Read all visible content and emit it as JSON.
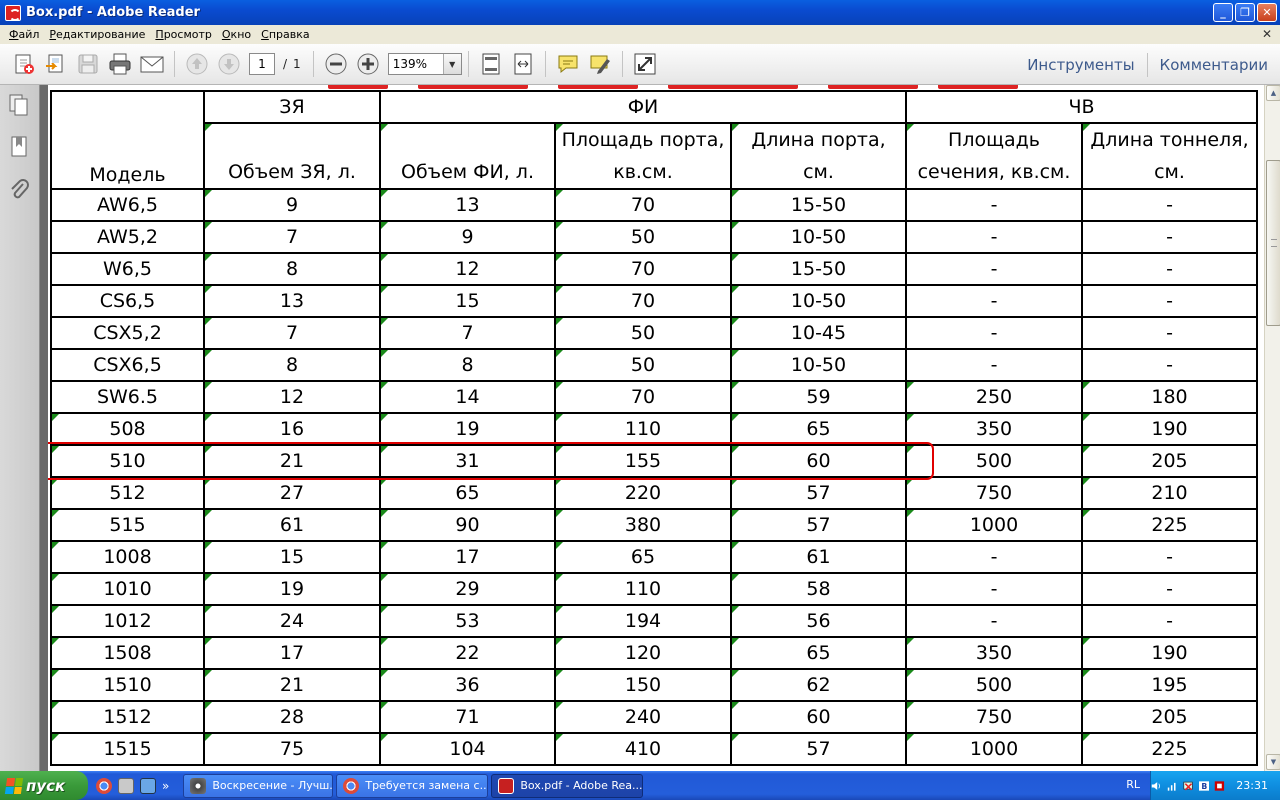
{
  "window": {
    "title": "Box.pdf - Adobe Reader"
  },
  "menu": {
    "items": [
      {
        "key": "Ф",
        "rest": "айл"
      },
      {
        "key": "Р",
        "rest": "едактирование"
      },
      {
        "key": "П",
        "rest": "росмотр"
      },
      {
        "key": "О",
        "rest": "кно"
      },
      {
        "key": "С",
        "rest": "правка"
      }
    ]
  },
  "toolbar": {
    "page_current": "1",
    "page_sep": "/",
    "page_total": "1",
    "zoom": "139%",
    "tools_label": "Инструменты",
    "comments_label": "Комментарии"
  },
  "table": {
    "group_headers": [
      "ЗЯ",
      "ФИ",
      "ЧВ"
    ],
    "columns": [
      "Модель",
      "Объем ЗЯ, л.",
      "Объем ФИ, л.",
      "Площадь порта,|кв.см.",
      "Длина порта,|см.",
      "Площадь|сечения, кв.см.",
      "Длина тоннеля,|см."
    ],
    "rows": [
      [
        "AW6,5",
        "9",
        "13",
        "70",
        "15-50",
        "-",
        "-"
      ],
      [
        "AW5,2",
        "7",
        "9",
        "50",
        "10-50",
        "-",
        "-"
      ],
      [
        "W6,5",
        "8",
        "12",
        "70",
        "15-50",
        "-",
        "-"
      ],
      [
        "CS6,5",
        "13",
        "15",
        "70",
        "10-50",
        "-",
        "-"
      ],
      [
        "CSX5,2",
        "7",
        "7",
        "50",
        "10-45",
        "-",
        "-"
      ],
      [
        "CSX6,5",
        "8",
        "8",
        "50",
        "10-50",
        "-",
        "-"
      ],
      [
        "SW6.5",
        "12",
        "14",
        "70",
        "59",
        "250",
        "180"
      ],
      [
        "508",
        "16",
        "19",
        "110",
        "65",
        "350",
        "190"
      ],
      [
        "510",
        "21",
        "31",
        "155",
        "60",
        "500",
        "205"
      ],
      [
        "512",
        "27",
        "65",
        "220",
        "57",
        "750",
        "210"
      ],
      [
        "515",
        "61",
        "90",
        "380",
        "57",
        "1000",
        "225"
      ],
      [
        "1008",
        "15",
        "17",
        "65",
        "61",
        "-",
        "-"
      ],
      [
        "1010",
        "19",
        "29",
        "110",
        "58",
        "-",
        "-"
      ],
      [
        "1012",
        "24",
        "53",
        "194",
        "56",
        "-",
        "-"
      ],
      [
        "1508",
        "17",
        "22",
        "120",
        "65",
        "350",
        "190"
      ],
      [
        "1510",
        "21",
        "36",
        "150",
        "62",
        "500",
        "195"
      ],
      [
        "1512",
        "28",
        "71",
        "240",
        "60",
        "750",
        "205"
      ],
      [
        "1515",
        "75",
        "104",
        "410",
        "57",
        "1000",
        "225"
      ]
    ]
  },
  "taskbar": {
    "start_label": "пуск",
    "tasks": [
      {
        "label": "Воскресение - Лучш...",
        "active": false
      },
      {
        "label": "Требуется замена с...",
        "active": false
      },
      {
        "label": "Box.pdf - Adobe Rea...",
        "active": true
      }
    ],
    "lang": "RL",
    "clock": "23:31",
    "quick_more": "»"
  },
  "colors": {
    "highlight": "#e00000",
    "corner_mark": "#1a8a1a",
    "xp_blue": "#245edb"
  }
}
